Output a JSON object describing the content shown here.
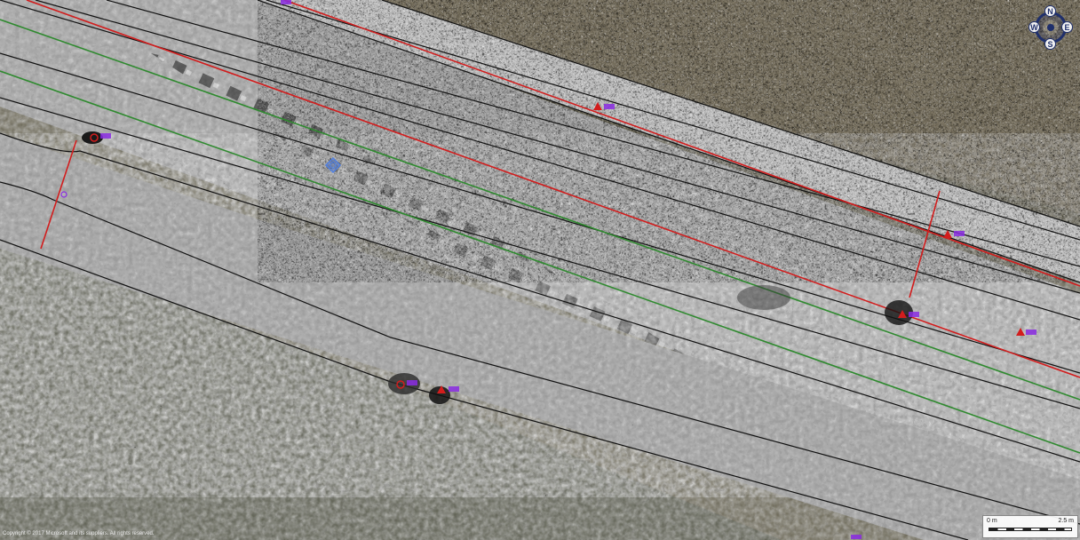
{
  "map": {
    "copyright": "Copyright © 2017 Microsoft and its suppliers. All rights reserved.",
    "scale": {
      "start": "0 m",
      "end": "2.5 m"
    },
    "compass": {
      "n": "N",
      "s": "S",
      "e": "E",
      "w": "W"
    },
    "colors": {
      "survey_strip": "#8f8f8f",
      "background_water": "#6a6654",
      "boundary_line": "#111111",
      "red_line": "#d21d1d",
      "green_line": "#2f8a2f",
      "target_label": "#8a2be2",
      "navy": "#1f2f6b"
    },
    "icons": [
      "compass-icon",
      "target-marker-icon",
      "waypoint-diamond-icon"
    ]
  }
}
